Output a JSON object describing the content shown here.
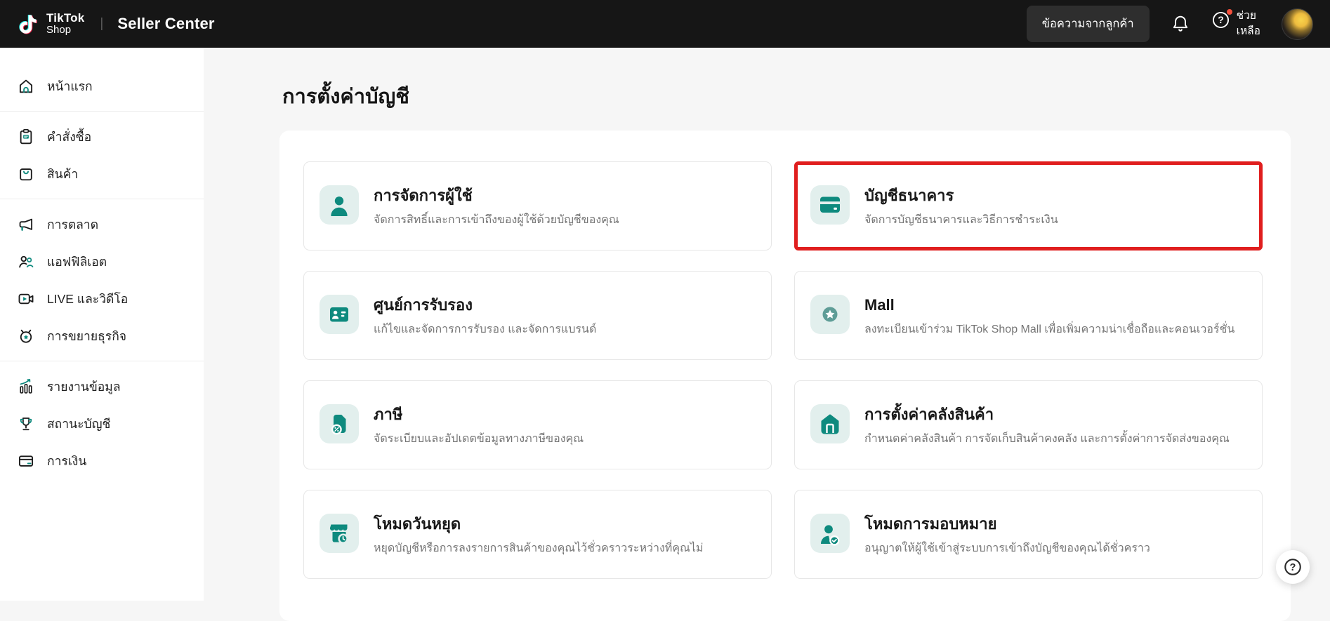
{
  "header": {
    "brand": {
      "line1": "TikTok",
      "line2": "Shop"
    },
    "separator": "|",
    "app_title": "Seller Center",
    "messages_button": "ข้อความจากลูกค้า",
    "help": {
      "line1": "ช่วย",
      "line2": "เหลือ"
    }
  },
  "sidebar": {
    "items": [
      {
        "label": "หน้าแรก"
      },
      {
        "label": "คำสั่งซื้อ"
      },
      {
        "label": "สินค้า"
      },
      {
        "label": "การตลาด"
      },
      {
        "label": "แอฟฟิลิเอต"
      },
      {
        "label": "LIVE และวิดีโอ"
      },
      {
        "label": "การขยายธุรกิจ"
      },
      {
        "label": "รายงานข้อมูล"
      },
      {
        "label": "สถานะบัญชี"
      },
      {
        "label": "การเงิน"
      }
    ]
  },
  "main": {
    "page_title": "การตั้งค่าบัญชี",
    "cards": [
      {
        "title": "การจัดการผู้ใช้",
        "description": "จัดการสิทธิ์และการเข้าถึงของผู้ใช้ด้วยบัญชีของคุณ",
        "icon": "user-management-icon",
        "highlighted": false
      },
      {
        "title": "บัญชีธนาคาร",
        "description": "จัดการบัญชีธนาคารและวิธีการชำระเงิน",
        "icon": "bank-card-icon",
        "highlighted": true
      },
      {
        "title": "ศูนย์การรับรอง",
        "description": "แก้ไขและจัดการการรับรอง และจัดการแบรนด์",
        "icon": "certification-icon",
        "highlighted": false
      },
      {
        "title": "Mall",
        "description": "ลงทะเบียนเข้าร่วม TikTok Shop Mall เพื่อเพิ่มความน่าเชื่อถือและคอนเวอร์ชั่น",
        "icon": "mall-icon",
        "highlighted": false
      },
      {
        "title": "ภาษี",
        "description": "จัดระเบียบและอัปเดตข้อมูลทางภาษีของคุณ",
        "icon": "tax-icon",
        "highlighted": false
      },
      {
        "title": "การตั้งค่าคลังสินค้า",
        "description": "กำหนดค่าคลังสินค้า การจัดเก็บสินค้าคงคลัง และการตั้งค่าการจัดส่งของคุณ",
        "icon": "warehouse-icon",
        "highlighted": false
      },
      {
        "title": "โหมดวันหยุด",
        "description": "หยุดบัญชีหรือการลงรายการสินค้าของคุณไว้ชั่วคราวระหว่างที่คุณไม่",
        "icon": "holiday-mode-icon",
        "highlighted": false
      },
      {
        "title": "โหมดการมอบหมาย",
        "description": "อนุญาตให้ผู้ใช้เข้าสู่ระบบการเข้าถึงบัญชีของคุณได้ชั่วคราว",
        "icon": "delegation-mode-icon",
        "highlighted": false
      }
    ]
  },
  "colors": {
    "header_bg": "#161616",
    "page_bg": "#f6f6f6",
    "accent_teal": "#0e8a7e",
    "accent_teal_light": "#e2efed",
    "mall_teal": "#5f9d97",
    "highlight_red": "#e01e1e",
    "card_border": "#e7e7e7",
    "text_primary": "#181818",
    "text_secondary": "#757575",
    "notification_red": "#f5503c"
  }
}
